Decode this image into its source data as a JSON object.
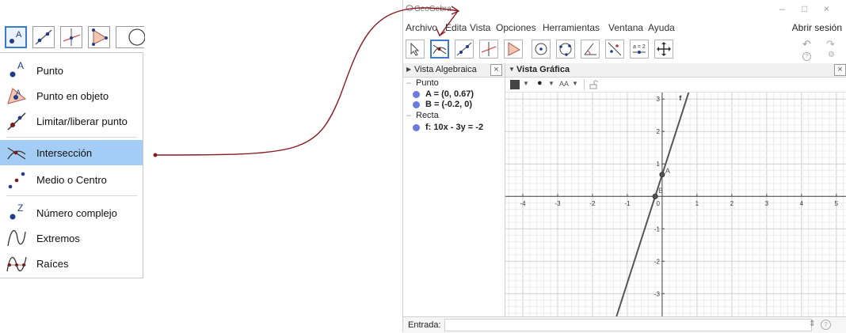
{
  "left_menu": {
    "items": [
      {
        "label": "Punto",
        "icon": "point-icon"
      },
      {
        "label": "Punto en objeto",
        "icon": "point-on-object-icon"
      },
      {
        "label": "Limitar/liberar punto",
        "icon": "attach-detach-point-icon"
      },
      {
        "label": "Intersección",
        "icon": "intersect-icon",
        "highlighted": true
      },
      {
        "label": "Medio o Centro",
        "icon": "midpoint-icon"
      },
      {
        "label": "Número complejo",
        "icon": "complex-number-icon"
      },
      {
        "label": "Extremos",
        "icon": "extremum-icon"
      },
      {
        "label": "Raíces",
        "icon": "roots-icon"
      }
    ]
  },
  "window": {
    "app_title": "GeoGebra",
    "minimize": "–",
    "maximize": "□",
    "close": "×",
    "menubar": [
      "Archivo",
      "Edita",
      "Vista",
      "Opciones",
      "Herramientas",
      "Ventana",
      "Ayuda"
    ],
    "sign_in": "Abrir sesión",
    "undo": "↶",
    "redo": "↷",
    "help": "?",
    "settings": "⚙",
    "tool_text": "a = 2"
  },
  "algebra_view": {
    "title": "Vista Algebraica",
    "close": "×",
    "groups": [
      {
        "name": "Punto",
        "items": [
          "A = (0, 0.67)",
          "B = (-0.2, 0)"
        ]
      },
      {
        "name": "Recta",
        "items": [
          "f: 10x - 3y = -2"
        ]
      }
    ]
  },
  "graphics_view": {
    "title": "Vista Gráfica",
    "close": "×",
    "text_style": "AA"
  },
  "input_bar": {
    "label": "Entrada:",
    "help": "?",
    "menu": "⇕"
  },
  "chart_data": {
    "type": "line",
    "xlim": [
      -4.5,
      5.3
    ],
    "ylim": [
      -3.7,
      3.2
    ],
    "x_ticks": [
      -4,
      -3,
      -2,
      -1,
      1,
      2,
      3,
      4,
      5
    ],
    "y_ticks": [
      -3,
      -2,
      -1,
      1,
      2,
      3
    ],
    "origin_label": "0",
    "grid": true,
    "line": {
      "name": "f",
      "equation": "10x - 3y = -2",
      "color": "#555555"
    },
    "points": [
      {
        "name": "A",
        "x": 0,
        "y": 0.67
      },
      {
        "name": "B",
        "x": -0.2,
        "y": 0
      }
    ]
  }
}
